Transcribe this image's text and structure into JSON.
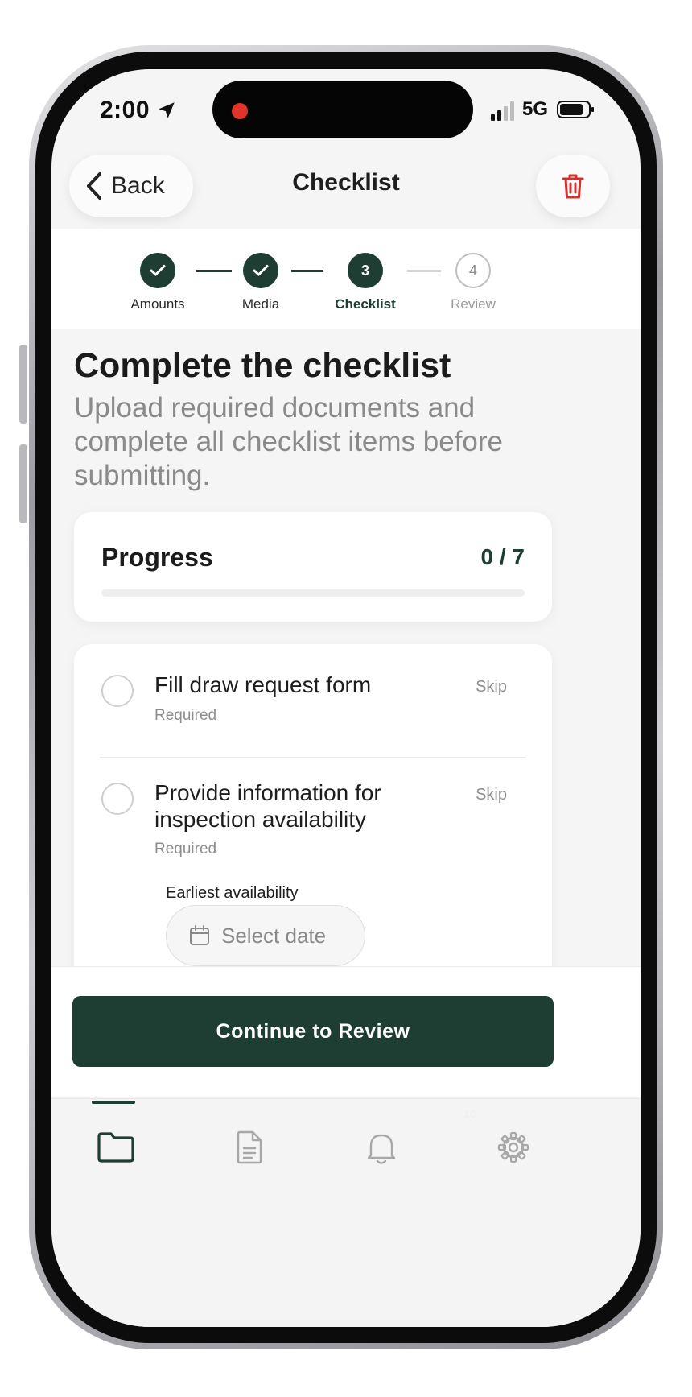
{
  "status_bar": {
    "time": "2:00",
    "network": "5G"
  },
  "nav": {
    "back_label": "Back",
    "title": "Checklist"
  },
  "stepper": {
    "steps": [
      {
        "label": "Amounts",
        "number": "",
        "state": "done"
      },
      {
        "label": "Media",
        "number": "",
        "state": "done"
      },
      {
        "label": "Checklist",
        "number": "3",
        "state": "current"
      },
      {
        "label": "Review",
        "number": "4",
        "state": "todo"
      }
    ]
  },
  "page": {
    "title": "Complete the checklist",
    "subtitle": "Upload required documents and complete all checklist items before submitting."
  },
  "progress": {
    "title": "Progress",
    "count": "0 / 7",
    "fraction": 0
  },
  "checklist": {
    "items": [
      {
        "title": "Fill draw request form",
        "subtitle": "Required",
        "skip_label": "Skip"
      },
      {
        "title": "Provide information for inspection availability",
        "subtitle": "Required",
        "skip_label": "Skip"
      }
    ],
    "availability_label": "Earliest availability",
    "date_placeholder": "Select date"
  },
  "cta": {
    "label": "Continue to Review"
  },
  "tab_bar": {
    "tabs": [
      {
        "icon": "folder-icon",
        "active": true
      },
      {
        "icon": "document-icon",
        "active": false
      },
      {
        "icon": "bell-icon",
        "active": false
      },
      {
        "icon": "gear-icon",
        "active": false
      }
    ],
    "notification_badge": "10"
  },
  "colors": {
    "primary": "#1e3d33",
    "delete": "#d0312d",
    "muted_text": "#8a8a8a"
  }
}
